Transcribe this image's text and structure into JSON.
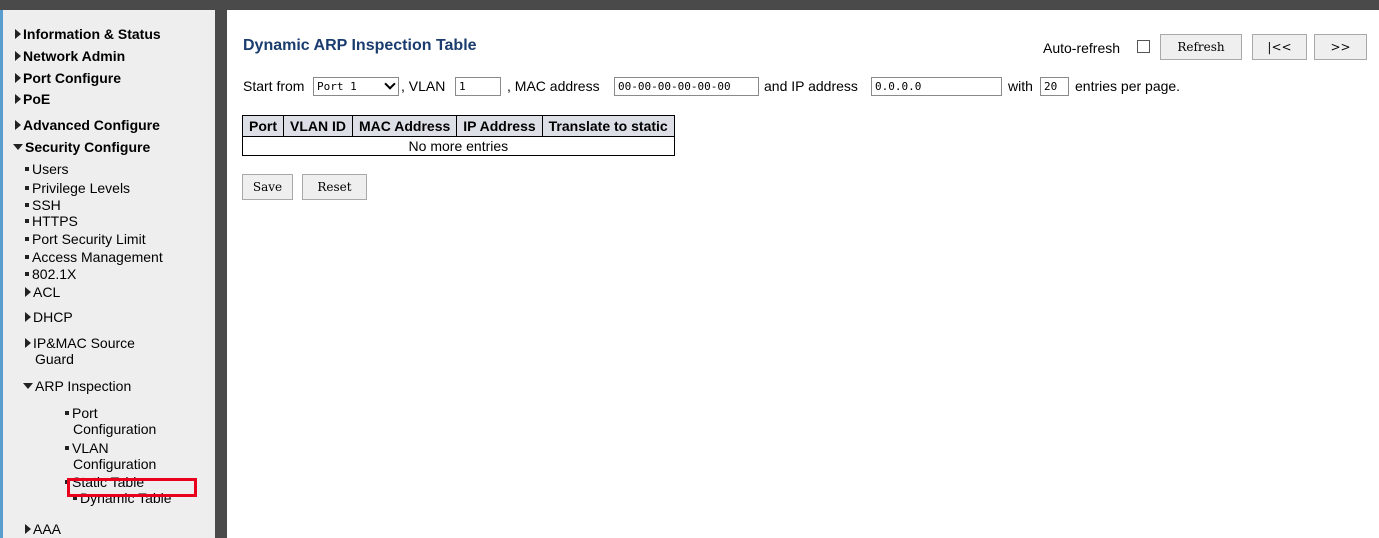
{
  "sidebar": {
    "items": [
      {
        "label": "Information & Status"
      },
      {
        "label": "Network Admin"
      },
      {
        "label": "Port Configure"
      },
      {
        "label": "PoE"
      },
      {
        "label": "Advanced Configure"
      },
      {
        "label": "Security Configure"
      }
    ],
    "security_sub": [
      {
        "label": "Users"
      },
      {
        "label": "Privilege Levels"
      },
      {
        "label": "SSH"
      },
      {
        "label": "HTTPS"
      },
      {
        "label": "Port Security Limit"
      },
      {
        "label": "Access Management"
      },
      {
        "label": "802.1X"
      }
    ],
    "security_groups": {
      "acl": "ACL",
      "dhcp": "DHCP",
      "ipmac_line1": "IP&MAC Source",
      "ipmac_line2": "Guard",
      "arp": "ARP Inspection",
      "aaa": "AAA"
    },
    "arp_sub": {
      "port_line1": "Port",
      "port_line2": "Configuration",
      "vlan_line1": "VLAN",
      "vlan_line2": "Configuration",
      "static": "Static Table",
      "dynamic": "Dynamic Table"
    }
  },
  "main": {
    "title": "Dynamic ARP Inspection Table",
    "auto_refresh_label": "Auto-refresh",
    "auto_refresh_checked": false,
    "refresh_button": "Refresh",
    "first_button": "|<<",
    "next_button": ">>",
    "filter": {
      "start_from_label": "Start from",
      "port_value": "Port 1",
      "vlan_label": ", VLAN",
      "vlan_value": "1",
      "mac_label": ", MAC address",
      "mac_value": "00-00-00-00-00-00",
      "ip_label": "and IP address",
      "ip_value": "0.0.0.0",
      "with_label": "with",
      "entries_value": "20",
      "entries_label": "entries per page."
    },
    "table": {
      "columns": [
        "Port",
        "VLAN ID",
        "MAC Address",
        "IP Address",
        "Translate to static"
      ],
      "empty_text": "No more entries"
    },
    "save_button": "Save",
    "reset_button": "Reset"
  }
}
